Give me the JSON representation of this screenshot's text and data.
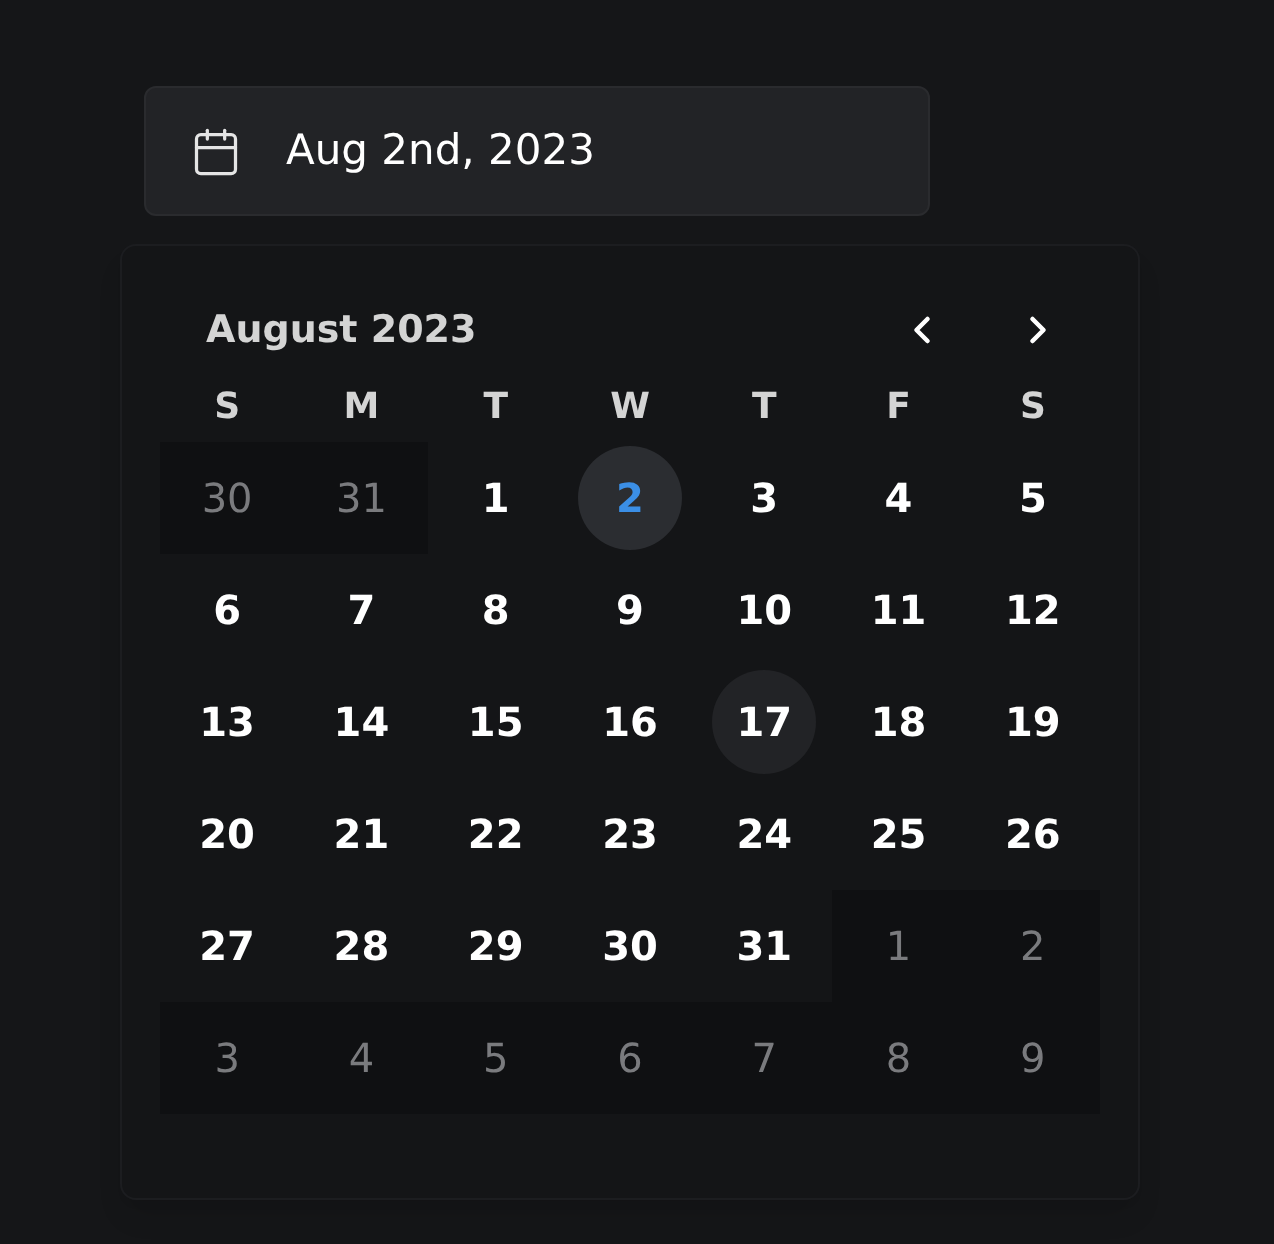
{
  "date_field": {
    "value": "Aug 2nd, 2023"
  },
  "calendar": {
    "caption": "August 2023",
    "weekdays": [
      "S",
      "M",
      "T",
      "W",
      "T",
      "F",
      "S"
    ],
    "weeks": [
      [
        {
          "label": "30",
          "outside": true,
          "selected": false,
          "today": false
        },
        {
          "label": "31",
          "outside": true,
          "selected": false,
          "today": false
        },
        {
          "label": "1",
          "outside": false,
          "selected": false,
          "today": false
        },
        {
          "label": "2",
          "outside": false,
          "selected": true,
          "today": false
        },
        {
          "label": "3",
          "outside": false,
          "selected": false,
          "today": false
        },
        {
          "label": "4",
          "outside": false,
          "selected": false,
          "today": false
        },
        {
          "label": "5",
          "outside": false,
          "selected": false,
          "today": false
        }
      ],
      [
        {
          "label": "6",
          "outside": false,
          "selected": false,
          "today": false
        },
        {
          "label": "7",
          "outside": false,
          "selected": false,
          "today": false
        },
        {
          "label": "8",
          "outside": false,
          "selected": false,
          "today": false
        },
        {
          "label": "9",
          "outside": false,
          "selected": false,
          "today": false
        },
        {
          "label": "10",
          "outside": false,
          "selected": false,
          "today": false
        },
        {
          "label": "11",
          "outside": false,
          "selected": false,
          "today": false
        },
        {
          "label": "12",
          "outside": false,
          "selected": false,
          "today": false
        }
      ],
      [
        {
          "label": "13",
          "outside": false,
          "selected": false,
          "today": false
        },
        {
          "label": "14",
          "outside": false,
          "selected": false,
          "today": false
        },
        {
          "label": "15",
          "outside": false,
          "selected": false,
          "today": false
        },
        {
          "label": "16",
          "outside": false,
          "selected": false,
          "today": false
        },
        {
          "label": "17",
          "outside": false,
          "selected": false,
          "today": true
        },
        {
          "label": "18",
          "outside": false,
          "selected": false,
          "today": false
        },
        {
          "label": "19",
          "outside": false,
          "selected": false,
          "today": false
        }
      ],
      [
        {
          "label": "20",
          "outside": false,
          "selected": false,
          "today": false
        },
        {
          "label": "21",
          "outside": false,
          "selected": false,
          "today": false
        },
        {
          "label": "22",
          "outside": false,
          "selected": false,
          "today": false
        },
        {
          "label": "23",
          "outside": false,
          "selected": false,
          "today": false
        },
        {
          "label": "24",
          "outside": false,
          "selected": false,
          "today": false
        },
        {
          "label": "25",
          "outside": false,
          "selected": false,
          "today": false
        },
        {
          "label": "26",
          "outside": false,
          "selected": false,
          "today": false
        }
      ],
      [
        {
          "label": "27",
          "outside": false,
          "selected": false,
          "today": false
        },
        {
          "label": "28",
          "outside": false,
          "selected": false,
          "today": false
        },
        {
          "label": "29",
          "outside": false,
          "selected": false,
          "today": false
        },
        {
          "label": "30",
          "outside": false,
          "selected": false,
          "today": false
        },
        {
          "label": "31",
          "outside": false,
          "selected": false,
          "today": false
        },
        {
          "label": "1",
          "outside": true,
          "selected": false,
          "today": false
        },
        {
          "label": "2",
          "outside": true,
          "selected": false,
          "today": false
        }
      ],
      [
        {
          "label": "3",
          "outside": true,
          "selected": false,
          "today": false
        },
        {
          "label": "4",
          "outside": true,
          "selected": false,
          "today": false
        },
        {
          "label": "5",
          "outside": true,
          "selected": false,
          "today": false
        },
        {
          "label": "6",
          "outside": true,
          "selected": false,
          "today": false
        },
        {
          "label": "7",
          "outside": true,
          "selected": false,
          "today": false
        },
        {
          "label": "8",
          "outside": true,
          "selected": false,
          "today": false
        },
        {
          "label": "9",
          "outside": true,
          "selected": false,
          "today": false
        }
      ]
    ]
  }
}
